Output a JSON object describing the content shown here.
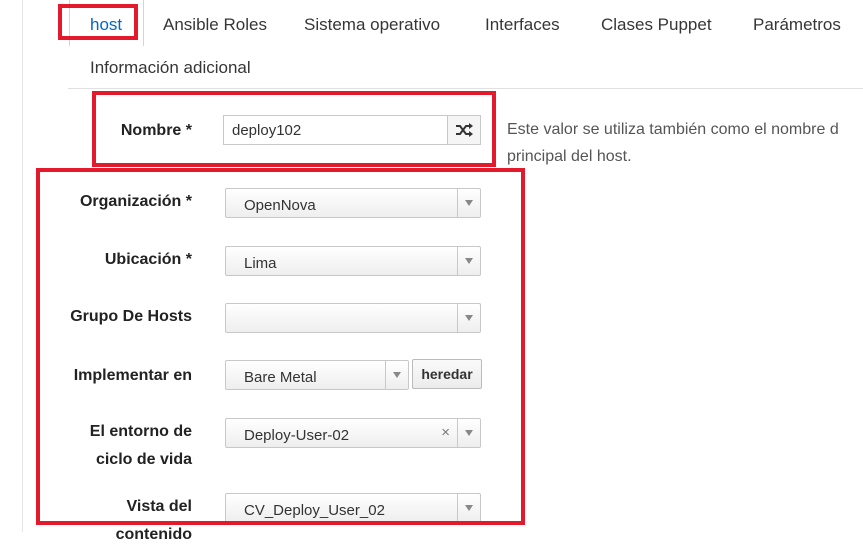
{
  "tabs": [
    {
      "label": "host",
      "active": true
    },
    {
      "label": "Ansible Roles"
    },
    {
      "label": "Sistema operativo"
    },
    {
      "label": "Interfaces"
    },
    {
      "label": "Clases Puppet"
    },
    {
      "label": "Parámetros"
    },
    {
      "label": "Información adicional"
    }
  ],
  "form": {
    "name": {
      "label": "Nombre *",
      "value": "deploy102",
      "help_line1": "Este valor se utiliza también como el nombre d",
      "help_line2": "principal del host."
    },
    "organization": {
      "label": "Organización *",
      "value": "OpenNova"
    },
    "location": {
      "label": "Ubicación *",
      "value": "Lima"
    },
    "hostgroup": {
      "label": "Grupo De Hosts",
      "value": ""
    },
    "deploy_on": {
      "label": "Implementar en",
      "value": "Bare Metal",
      "inherit_label": "heredar"
    },
    "lifecycle_env": {
      "label_line1": "El entorno de",
      "label_line2": "ciclo de vida",
      "value": "Deploy-User-02",
      "clear_glyph": "×"
    },
    "content_view": {
      "label_line1": "Vista del",
      "label_line2": "contenido",
      "value": "CV_Deploy_User_02"
    }
  },
  "colors": {
    "accent": "#0066cc",
    "highlight": "#e21a2b"
  },
  "icons": {
    "shuffle": "shuffle-icon",
    "caret": "chevron-down-icon"
  }
}
